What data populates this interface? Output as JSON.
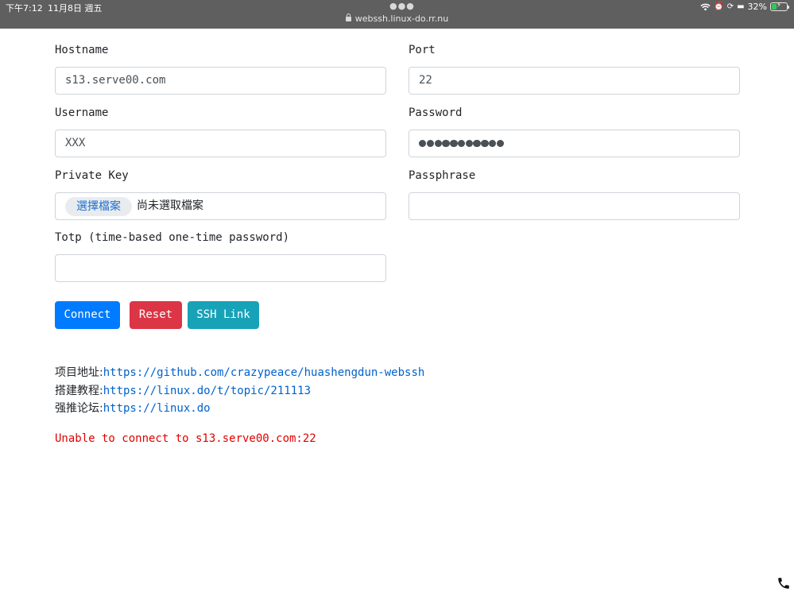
{
  "status_bar": {
    "time": "下午7:12",
    "date": "11月8日 週五",
    "url": "webssh.linux-do.rr.nu",
    "battery_percent": "32%",
    "battery_level": 0.32
  },
  "form": {
    "hostname": {
      "label": "Hostname",
      "value": "s13.serve00.com"
    },
    "port": {
      "label": "Port",
      "value": "22"
    },
    "username": {
      "label": "Username",
      "value": "XXX"
    },
    "password": {
      "label": "Password",
      "masked_length": 11
    },
    "private_key": {
      "label": "Private Key",
      "button": "選擇檔案",
      "status": "尚未選取檔案"
    },
    "passphrase": {
      "label": "Passphrase",
      "value": ""
    },
    "totp": {
      "label": "Totp (time-based one-time password)",
      "value": ""
    }
  },
  "buttons": {
    "connect": "Connect",
    "reset": "Reset",
    "ssh_link": "SSH Link"
  },
  "info": [
    {
      "label": "项目地址:",
      "value": "https://github.com/crazypeace/huashengdun-webssh"
    },
    {
      "label": "搭建教程:",
      "value": "https://linux.do/t/topic/211113"
    },
    {
      "label": "强推论坛:",
      "value": "https://linux.do"
    }
  ],
  "error_message": "Unable to connect to s13.serve00.com:22",
  "colors": {
    "primary": "#007bff",
    "danger": "#dc3545",
    "info": "#17a2b8",
    "link": "#0062cc",
    "error": "#e00000"
  }
}
